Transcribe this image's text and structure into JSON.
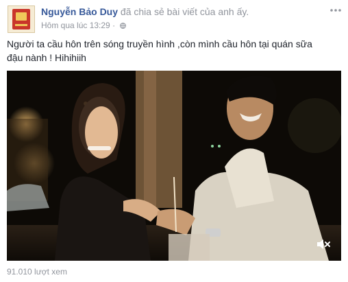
{
  "post": {
    "author": "Nguyễn Bảo Duy",
    "action": " đã chia sẻ bài viết của anh ấy.",
    "timestamp": "Hôm qua lúc 13:29",
    "separator": " · ",
    "privacy_icon": "globe-icon",
    "menu_icon": "more-horizontal-icon",
    "text": "Người ta cầu hôn trên sóng truyền hình ,còn mình cầu hôn tại quán sữa đậu nành ! Hihihiih"
  },
  "video": {
    "mute_icon": "speaker-muted-icon",
    "view_count": "91.010 lượt xem"
  },
  "colors": {
    "author_link": "#365899",
    "secondary_text": "#90949c",
    "body_text": "#1d2129"
  }
}
